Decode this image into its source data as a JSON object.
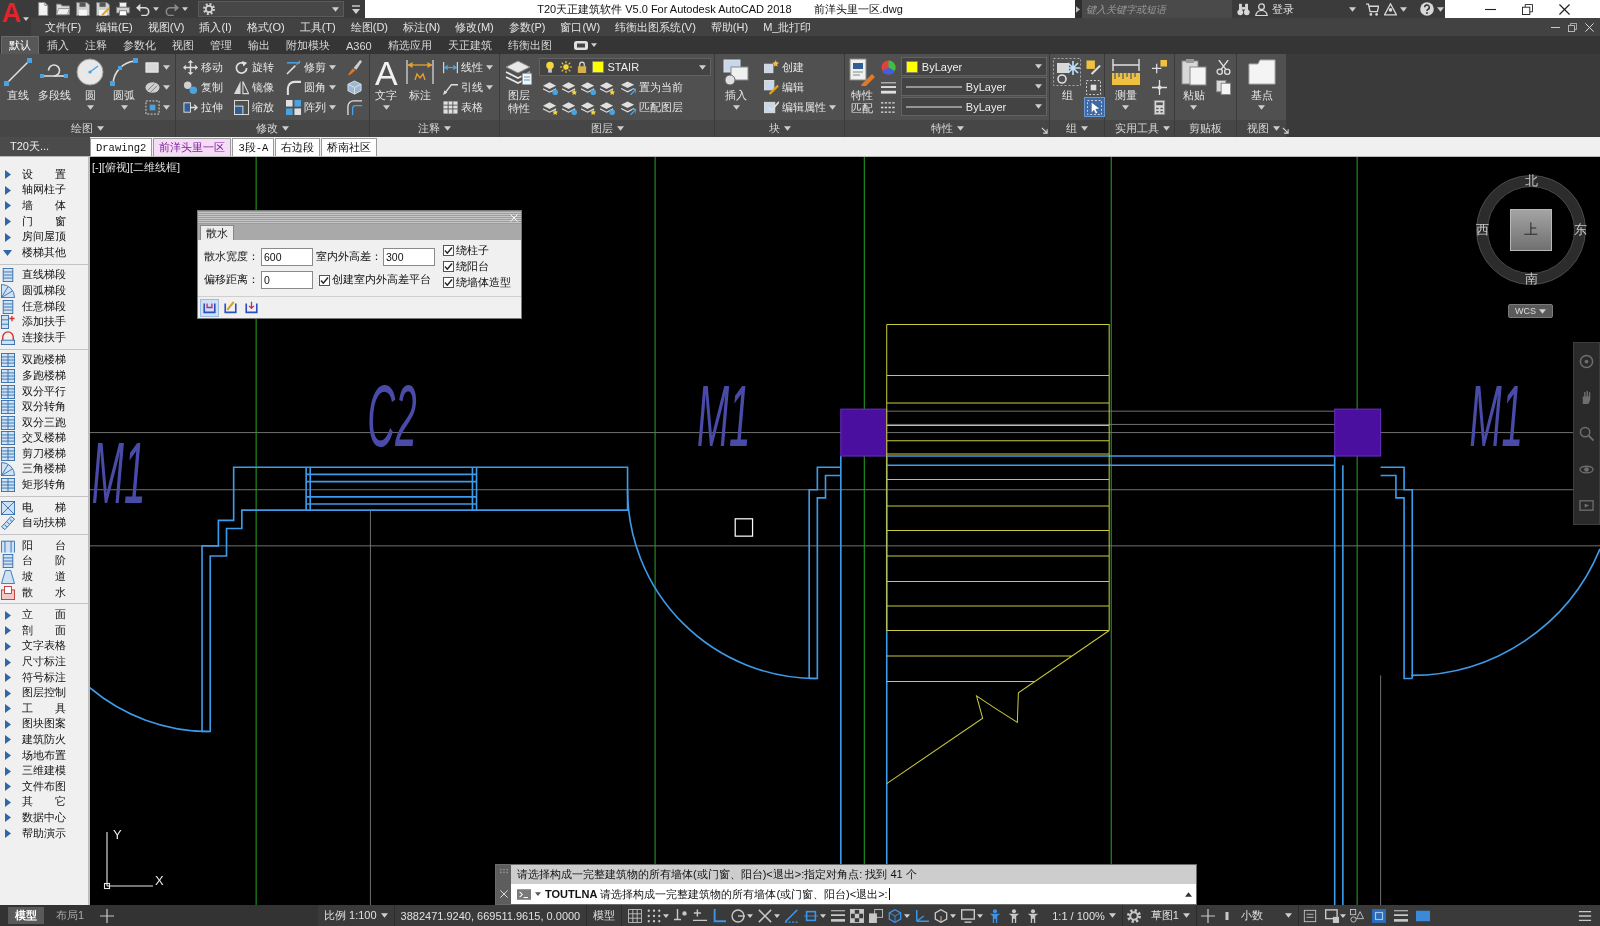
{
  "app_menu": {
    "label": "A"
  },
  "title_bar": {
    "title": "T20天正建筑软件 V5.0 For Autodesk AutoCAD 2018",
    "document": "前洋头里一区.dwg",
    "search": {
      "placeholder": "键入关键字或短语"
    },
    "sign_in": "登录"
  },
  "menu_bar": {
    "items": [
      "文件(F)",
      "编辑(E)",
      "视图(V)",
      "插入(I)",
      "格式(O)",
      "工具(T)",
      "绘图(D)",
      "标注(N)",
      "修改(M)",
      "参数(P)",
      "窗口(W)",
      "纬衡出图系统(V)",
      "帮助(H)",
      "M_批打印"
    ]
  },
  "ribbon": {
    "tabs": [
      {
        "label": "默认",
        "selected": true
      },
      {
        "label": "插入",
        "selected": false
      },
      {
        "label": "注释",
        "selected": false
      },
      {
        "label": "参数化",
        "selected": false
      },
      {
        "label": "视图",
        "selected": false
      },
      {
        "label": "管理",
        "selected": false
      },
      {
        "label": "输出",
        "selected": false
      },
      {
        "label": "附加模块",
        "selected": false
      },
      {
        "label": "A360",
        "selected": false
      },
      {
        "label": "精选应用",
        "selected": false
      },
      {
        "label": "天正建筑",
        "selected": false
      },
      {
        "label": "纬衡出图",
        "selected": false
      }
    ],
    "panels": [
      {
        "title": "绘图",
        "menu": true,
        "launcher": false,
        "tools": [
          {
            "kind": "large",
            "label": "直线",
            "dropdown": false
          },
          {
            "kind": "large",
            "label": "多段线",
            "dropdown": false
          },
          {
            "kind": "large",
            "label": "圆",
            "dropdown": true
          },
          {
            "kind": "large",
            "label": "圆弧",
            "dropdown": true
          },
          {
            "kind": "stack",
            "rows": [
              {
                "kind": "button",
                "dropdown": true
              },
              {
                "kind": "button",
                "dropdown": true
              },
              {
                "kind": "button",
                "dropdown": true
              }
            ]
          }
        ]
      },
      {
        "title": "修改",
        "menu": true,
        "launcher": false,
        "tools": [
          {
            "kind": "stack",
            "rows": [
              {
                "kind": "button",
                "label": "移动",
                "dropdown": false
              },
              {
                "kind": "button",
                "label": "复制",
                "dropdown": false
              },
              {
                "kind": "button",
                "label": "拉伸",
                "dropdown": false
              }
            ]
          },
          {
            "kind": "stack",
            "rows": [
              {
                "kind": "button",
                "label": "旋转",
                "dropdown": false
              },
              {
                "kind": "button",
                "label": "镜像",
                "dropdown": false
              },
              {
                "kind": "button",
                "label": "缩放",
                "dropdown": false
              }
            ]
          },
          {
            "kind": "stack",
            "rows": [
              {
                "kind": "button",
                "label": "修剪",
                "dropdown": true
              },
              {
                "kind": "button",
                "label": "圆角",
                "dropdown": true
              },
              {
                "kind": "button",
                "label": "阵列",
                "dropdown": true
              }
            ]
          },
          {
            "kind": "stack",
            "rows": [
              {
                "kind": "button",
                "dropdown": false
              },
              {
                "kind": "button",
                "dropdown": false
              },
              {
                "kind": "button",
                "dropdown": false
              }
            ]
          }
        ]
      },
      {
        "title": "注释",
        "menu": true,
        "launcher": false,
        "tools": [
          {
            "kind": "large",
            "label": "文字",
            "icon_text": "A",
            "dropdown": true
          },
          {
            "kind": "large",
            "label": "标注",
            "dropdown": false
          },
          {
            "kind": "stack",
            "rows": [
              {
                "kind": "button",
                "label": "线性",
                "dropdown": true
              },
              {
                "kind": "button",
                "label": "引线",
                "dropdown": true
              },
              {
                "kind": "button",
                "label": "表格",
                "dropdown": false
              }
            ]
          }
        ]
      },
      {
        "title": "图层",
        "menu": true,
        "launcher": false,
        "tools": [
          {
            "kind": "large",
            "label": "图层特性",
            "dropdown": false
          },
          {
            "kind": "stack",
            "rows": [
              {
                "kind": "dropdown",
                "value": "STAIR"
              },
              {
                "kind": "tools",
                "label": "置为当前"
              },
              {
                "kind": "tools",
                "label": "匹配图层"
              }
            ]
          }
        ]
      },
      {
        "title": "块",
        "menu": true,
        "launcher": false,
        "tools": [
          {
            "kind": "large",
            "label": "插入",
            "dropdown": true
          },
          {
            "kind": "stack",
            "rows": [
              {
                "kind": "button",
                "label": "创建",
                "dropdown": false
              },
              {
                "kind": "button",
                "label": "编辑",
                "dropdown": false
              },
              {
                "kind": "button",
                "label": "编辑属性",
                "dropdown": true
              }
            ]
          }
        ]
      },
      {
        "title": "特性",
        "menu": true,
        "launcher": true,
        "tools": [
          {
            "kind": "large",
            "label": "特性匹配",
            "dropdown": false
          },
          {
            "kind": "stack",
            "rows": [
              {
                "kind": "button",
                "dropdown": false
              },
              {
                "kind": "button",
                "dropdown": false
              },
              {
                "kind": "button",
                "dropdown": false
              }
            ]
          },
          {
            "kind": "stack",
            "rows": [
              {
                "kind": "dropdown",
                "value": "ByLayer"
              },
              {
                "kind": "dropdown",
                "value": "ByLayer"
              },
              {
                "kind": "dropdown",
                "value": "ByLayer"
              }
            ]
          }
        ]
      },
      {
        "title": "组",
        "menu": true,
        "launcher": false,
        "tools": [
          {
            "kind": "large",
            "label": "组",
            "dropdown": false
          },
          {
            "kind": "stack",
            "rows": [
              {
                "kind": "button",
                "dropdown": false,
                "on": false
              },
              {
                "kind": "button",
                "dropdown": false,
                "on": false
              },
              {
                "kind": "button",
                "dropdown": false,
                "on": true
              }
            ]
          }
        ]
      },
      {
        "title": "实用工具",
        "menu": true,
        "launcher": false,
        "tools": [
          {
            "kind": "large",
            "label": "测量",
            "dropdown": true
          },
          {
            "kind": "stack",
            "rows": [
              {
                "kind": "button",
                "dropdown": false
              },
              {
                "kind": "button",
                "dropdown": false
              },
              {
                "kind": "button",
                "dropdown": false
              }
            ]
          }
        ]
      },
      {
        "title": "剪贴板",
        "menu": false,
        "launcher": false,
        "tools": [
          {
            "kind": "large",
            "label": "粘贴",
            "dropdown": true
          },
          {
            "kind": "stack",
            "rows": [
              {
                "kind": "button",
                "dropdown": false
              },
              {
                "kind": "button",
                "dropdown": false
              }
            ]
          }
        ]
      },
      {
        "title": "视图",
        "menu": true,
        "launcher": true,
        "tools": [
          {
            "kind": "large",
            "label": "基点",
            "dropdown": true
          }
        ]
      }
    ]
  },
  "document_tabs": [
    {
      "label": "Drawing2",
      "selected": false
    },
    {
      "label": "前洋头里一区",
      "selected": true
    },
    {
      "label": "3段-A",
      "selected": false
    },
    {
      "label": "右边段",
      "selected": false
    },
    {
      "label": "桥南社区",
      "selected": false
    }
  ],
  "sidebar": {
    "title": "T20天...",
    "items": [
      {
        "label": "设　　置",
        "expanded": false
      },
      {
        "label": "轴网柱子",
        "expanded": false
      },
      {
        "label": "墙　　体",
        "expanded": false
      },
      {
        "label": "门　　窗",
        "expanded": false
      },
      {
        "label": "房间屋顶",
        "expanded": false
      },
      {
        "label": "楼梯其他",
        "expanded": true,
        "children": [
          {
            "label": "直线梯段",
            "group_start": true
          },
          {
            "label": "圆弧梯段",
            "group_start": false
          },
          {
            "label": "任意梯段",
            "group_start": false
          },
          {
            "label": "添加扶手",
            "group_start": false
          },
          {
            "label": "连接扶手",
            "group_start": false
          },
          {
            "label": "双跑楼梯",
            "group_start": true
          },
          {
            "label": "多跑楼梯",
            "group_start": false
          },
          {
            "label": "双分平行",
            "group_start": false
          },
          {
            "label": "双分转角",
            "group_start": false
          },
          {
            "label": "双分三跑",
            "group_start": false
          },
          {
            "label": "交叉楼梯",
            "group_start": false
          },
          {
            "label": "剪刀楼梯",
            "group_start": false
          },
          {
            "label": "三角楼梯",
            "group_start": false
          },
          {
            "label": "矩形转角",
            "group_start": false
          },
          {
            "label": "电　　梯",
            "group_start": true
          },
          {
            "label": "自动扶梯",
            "group_start": false
          },
          {
            "label": "阳　　台",
            "group_start": true
          },
          {
            "label": "台　　阶",
            "group_start": false
          },
          {
            "label": "坡　　道",
            "group_start": false
          },
          {
            "label": "散　　水",
            "group_start": false
          }
        ]
      },
      {
        "label": "立　　面",
        "expanded": false
      },
      {
        "label": "剖　　面",
        "expanded": false
      },
      {
        "label": "文字表格",
        "expanded": false
      },
      {
        "label": "尺寸标注",
        "expanded": false
      },
      {
        "label": "符号标注",
        "expanded": false
      },
      {
        "label": "图层控制",
        "expanded": false
      },
      {
        "label": "工　　具",
        "expanded": false
      },
      {
        "label": "图块图案",
        "expanded": false
      },
      {
        "label": "建筑防火",
        "expanded": false
      },
      {
        "label": "场地布置",
        "expanded": false
      },
      {
        "label": "三维建模",
        "expanded": false
      },
      {
        "label": "文件布图",
        "expanded": false
      },
      {
        "label": "其　　它",
        "expanded": false
      },
      {
        "label": "数据中心",
        "expanded": false
      },
      {
        "label": "帮助演示",
        "expanded": false
      }
    ]
  },
  "viewport": {
    "controls_label": "[-][俯视][二维线框]",
    "labels": [
      "M1",
      "C2",
      "M1",
      "M1"
    ],
    "viewcube": {
      "top": "上",
      "north": "北",
      "south": "南",
      "west": "西",
      "east": "东",
      "coordinate_system": "WCS"
    },
    "ucs": {
      "x": "X",
      "y": "Y"
    }
  },
  "dialog": {
    "tab": "散水",
    "fields": [
      {
        "label": "散水宽度：",
        "value": "600"
      },
      {
        "label": "室内外高差：",
        "value": "300"
      },
      {
        "label": "偏移距离：",
        "value": "0"
      }
    ],
    "checkboxes": [
      {
        "label": "创建室内外高差平台",
        "checked": true
      },
      {
        "label": "绕柱子",
        "checked": true
      },
      {
        "label": "绕阳台",
        "checked": true
      },
      {
        "label": "绕墙体造型",
        "checked": true
      }
    ],
    "tool_buttons": [
      {
        "selected": true
      },
      {
        "selected": false
      },
      {
        "selected": false
      }
    ]
  },
  "command_line": {
    "history": "请选择构成一完整建筑物的所有墙体(或门窗、阳台)<退出>:指定对角点: 找到 41 个",
    "prompt": "**TOUTLNA** 请选择构成一完整建筑物的所有墙体(或门窗、阳台)<退出>:"
  },
  "status_bar": {
    "layout_tabs": [
      {
        "label": "模型",
        "selected": true
      },
      {
        "label": "布局1",
        "selected": false
      }
    ],
    "scale": "比例 1:100",
    "coordinates": "3882471.9240, 669511.9615, 0.0000",
    "space": "模型",
    "toggles": [
      {
        "on": false
      },
      {
        "on": false
      },
      {
        "on": false
      },
      {
        "on": false
      },
      {
        "on": true
      },
      {
        "on": false
      },
      {
        "on": false
      },
      {
        "on": true
      },
      {
        "on": true
      },
      {
        "on": false
      },
      {
        "on": false
      },
      {
        "on": false
      },
      {
        "on": true
      },
      {
        "on": true
      },
      {
        "on": false
      },
      {
        "on": false
      },
      {
        "on": true
      },
      {
        "on": false
      },
      {
        "on": false
      }
    ],
    "annotation_scale": "1:1 / 100%",
    "workspace": "草图1",
    "units": "小数"
  }
}
